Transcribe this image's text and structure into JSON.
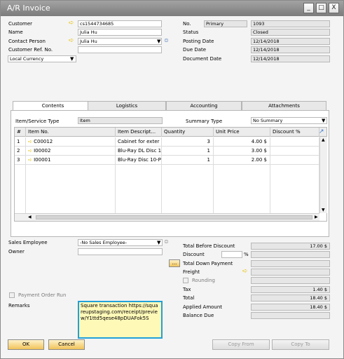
{
  "window": {
    "title": "A/R Invoice",
    "controls": [
      "_",
      "□",
      "X"
    ]
  },
  "header_left": {
    "customer_label": "Customer",
    "customer_value": "cs1544734685",
    "name_label": "Name",
    "name_value": "Julia Hu",
    "contact_label": "Contact Person",
    "contact_value": "Julia Hu",
    "ref_label": "Customer Ref. No.",
    "ref_value": "",
    "currency_value": "Local Currency"
  },
  "header_right": {
    "no_label": "No.",
    "series_value": "Primary",
    "no_value": "1093",
    "status_label": "Status",
    "status_value": "Closed",
    "posting_label": "Posting Date",
    "posting_value": "12/14/2018",
    "due_label": "Due Date",
    "due_value": "12/14/2018",
    "doc_label": "Document Date",
    "doc_value": "12/14/2018"
  },
  "tabs": [
    "Contents",
    "Logistics",
    "Accounting",
    "Attachments"
  ],
  "contents": {
    "item_service_label": "Item/Service Type",
    "item_service_value": "Item",
    "summary_label": "Summary Type",
    "summary_value": "No Summary"
  },
  "grid": {
    "columns": [
      "#",
      "Item No.",
      "Item Descript...",
      "Quantity",
      "Unit Price",
      "Discount %"
    ],
    "rows": [
      {
        "num": "1",
        "item_no": "C00012",
        "desc": "Cabinet for exter",
        "qty": "3",
        "price": "4.00 $"
      },
      {
        "num": "2",
        "item_no": "I00002",
        "desc": "Blu-Ray DL Disc 1",
        "qty": "1",
        "price": "3.00 $"
      },
      {
        "num": "3",
        "item_no": "I00001",
        "desc": "Blu-Ray Disc 10-P",
        "qty": "1",
        "price": "2.00 $"
      }
    ]
  },
  "footer_left": {
    "sales_employee_label": "Sales Employee",
    "sales_employee_value": "-No Sales Employee-",
    "owner_label": "Owner",
    "owner_value": "",
    "payment_order_label": "Payment Order Run",
    "remarks_label": "Remarks",
    "remarks_value": "Square transaction https://squareupstaging.com/receipt/preview/Y1ttd5qese48pDUAFok5S"
  },
  "totals": {
    "before_discount_label": "Total Before Discount",
    "before_discount_value": "17.00 $",
    "discount_label": "Discount",
    "discount_pct_symbol": "%",
    "down_payment_label": "Total Down Payment",
    "freight_label": "Freight",
    "rounding_label": "Rounding",
    "tax_label": "Tax",
    "tax_value": "1.40 $",
    "total_label": "Total",
    "total_value": "18.40 $",
    "applied_label": "Applied Amount",
    "applied_value": "18.40 $",
    "balance_label": "Balance Due",
    "balance_value": ""
  },
  "buttons": {
    "ok": "OK",
    "cancel": "Cancel",
    "copy_from": "Copy From",
    "copy_to": "Copy To",
    "ellipsis": "..."
  },
  "colors": {
    "accent_arrow": "#e8c000",
    "remarks_highlight": "#21a0d8"
  }
}
